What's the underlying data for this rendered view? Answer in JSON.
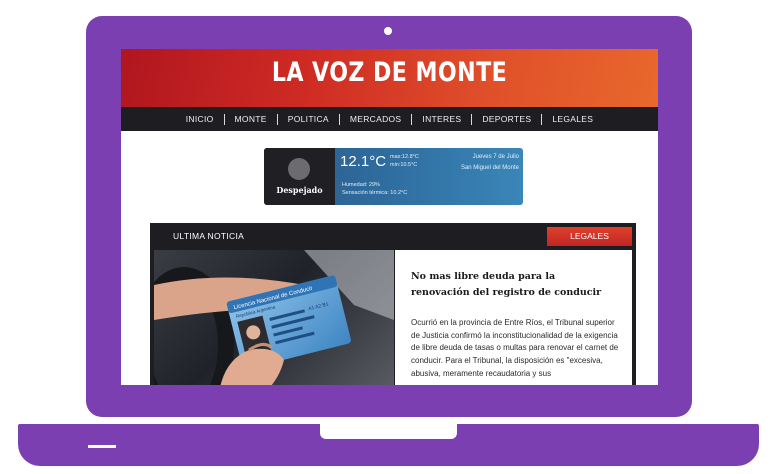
{
  "site": {
    "title": "LA VOZ DE MONTE"
  },
  "nav": {
    "items": [
      "INICIO",
      "MONTE",
      "POLITICA",
      "MERCADOS",
      "INTERES",
      "DEPORTES",
      "LEGALES"
    ]
  },
  "weather": {
    "condition": "Despejado",
    "temperature": "12.1°C",
    "max": "max:12.8°C",
    "min": "min:10.5°C",
    "date": "Jueves 7 de Julio",
    "location": "San Miguel del Monte",
    "humidity": "Humedad: 29%",
    "feels_like": "Sensación térmica: 10.2°C"
  },
  "news": {
    "section_label": "ULTIMA NOTICIA",
    "category_badge": "LEGALES",
    "headline": "No mas libre deuda para la renovación del registro de conducir",
    "excerpt": "Ocurrió en la provincia de Entre Ríos, el Tribunal superior de Justicia confirmó la inconstitucionalidad de la exigencia de libre deuda de tasas o multas para renovar el carnet de conducir. Para el Tribunal, la disposición es \"excesiva, abusiva, meramente recaudatoria y sus",
    "license_card": {
      "header": "Licencia Nacional de Conducir",
      "country": "República Argentina",
      "class": "A1 A2 B1"
    }
  },
  "colors": {
    "frame": "#7b3fb1",
    "accent": "#d32f24",
    "nav_bg": "#1d1d22",
    "weather": "#2f6c9e"
  }
}
